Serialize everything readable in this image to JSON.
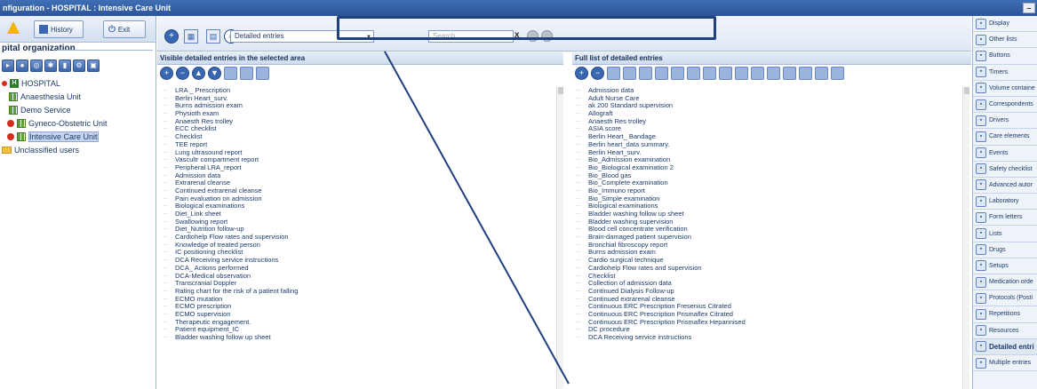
{
  "window": {
    "title": "nfiguration - HOSPITAL : Intensive Care Unit",
    "min_btn": "–"
  },
  "left": {
    "history": "History",
    "exit": "Exit",
    "org_title": "pital organization",
    "tree": [
      {
        "label": "HOSPITAL",
        "icon": "hospital-icon"
      },
      {
        "label": "Anaesthesia Unit",
        "icon": "grid-icon"
      },
      {
        "label": "Demo Service",
        "icon": "grid-icon"
      },
      {
        "label": "Gyneco-Obstetric Unit",
        "icon": "grid-icon"
      },
      {
        "label": "Intensive Care Unit",
        "icon": "grid-icon",
        "selected": true
      },
      {
        "label": "Unclassified users",
        "icon": "folder-icon"
      }
    ]
  },
  "toolbar": {
    "entries_type": "Detailed entries",
    "search_placeholder": "Search",
    "clear": "x"
  },
  "visible_panel": {
    "title": "Visible detailed entries in the selected area",
    "items": [
      "LRA _ Prescription",
      "Berlin Heart_surv.",
      "Burns admission exam",
      "Physioth exam",
      "Anaesth Res trolley",
      "ECC checklist",
      "Checklist",
      "TEE report",
      "Lung ultrasound report",
      "Vascultr compartment report",
      "Peripheral LRA_report",
      "Admission data",
      "Extrarenal cleanse",
      "Continued extrarenal cleanse",
      "Pain evaluation on admission",
      "Biological examinations",
      "Diet_Link sheet",
      "Swallowing report",
      "Diet_Nutrition follow-up",
      "Cardiohelp Flow rates and supervision",
      "Knowledge of treated person",
      "IC positioning checklist",
      "DCA Receiving service instructions",
      "DCA_ Actions performed",
      "DCA-Medical observation",
      "Transcranial Doppler",
      "Rating chart for the risk of a patient falling",
      "ECMO mutation",
      "ECMO prescription",
      "ECMO supervision",
      "Therapeutic engagement.",
      "Patient equipment_IC",
      "Bladder washing follow up sheet"
    ]
  },
  "full_panel": {
    "title": "Full list of detailed entries",
    "items": [
      "Admission data",
      "Adult Nurse Care",
      "ak 200 Standard supervision",
      "Allograft",
      "Anaesth Res trolley",
      "ASIA score",
      "Berlin Heart_ Bandage",
      "Berlin heart_data summary.",
      "Berlin Heart_surv.",
      "Bio_Admission examination",
      "Bio_Biological examination 2",
      "Bio_Blood gas",
      "Bio_Complete examination",
      "Bio_Immuno report",
      "Bio_Simple examination",
      "Biological examinations",
      "Bladder washing follow up sheet",
      "Bladder washing supervision",
      "Blood cell concentrate verification",
      "Brain-damaged patient supervision",
      "Bronchial fibroscopy report",
      "Burns admission exam",
      "Cardio surgical technique",
      "Cardiohelp Flow rates and supervision",
      "Checklist",
      "Collection of admission data",
      "Continued Dialysis Follow-up",
      "Continued extrarenal cleanse",
      "Continuous ERC Prescription Fresenius Citrated",
      "Continuous ERC Prescription Prismaflex Citrated",
      "Continuous ERC Prescription Prismaflex Heparinised",
      "DC procedure",
      "DCA Receiving service instructions"
    ]
  },
  "right": {
    "items": [
      {
        "label": "Display",
        "icon": "monitor-icon"
      },
      {
        "label": "Other lists",
        "icon": "list-icon"
      },
      {
        "label": "Buttons",
        "icon": "buttons-icon"
      },
      {
        "label": "Timers",
        "icon": "clock-icon"
      },
      {
        "label": "Volume containe",
        "icon": "syringe-icon"
      },
      {
        "label": "Correspondents",
        "icon": "person-icon"
      },
      {
        "label": "Drivers",
        "icon": "wave-icon"
      },
      {
        "label": "Care elements",
        "icon": "drop-icon"
      },
      {
        "label": "Events",
        "icon": "table-icon"
      },
      {
        "label": "Safety checklist",
        "icon": "checklist-icon"
      },
      {
        "label": "Advanced autor",
        "icon": "gears-icon"
      },
      {
        "label": "Laboratory",
        "icon": "lab-icon"
      },
      {
        "label": "Form letters",
        "icon": "letter-icon"
      },
      {
        "label": "Lists",
        "icon": "lists-icon"
      },
      {
        "label": "Drugs",
        "icon": "drugs-icon"
      },
      {
        "label": "Setups",
        "icon": "setup-icon"
      },
      {
        "label": "Medication orde",
        "icon": "medication-icon"
      },
      {
        "label": "Protocols (Posti",
        "icon": "protocol-icon"
      },
      {
        "label": "Repetitions",
        "icon": "repeat-icon"
      },
      {
        "label": "Resources",
        "icon": "resources-icon"
      },
      {
        "label": "Detailed entri",
        "icon": "detailed-icon",
        "active": true
      },
      {
        "label": "Multiple entries",
        "icon": "multiple-icon"
      }
    ]
  }
}
